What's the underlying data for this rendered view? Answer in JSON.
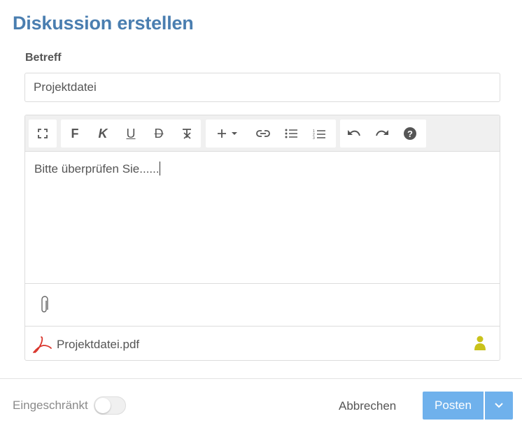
{
  "dialog": {
    "title": "Diskussion erstellen"
  },
  "subject": {
    "label": "Betreff",
    "value": "Projektdatei"
  },
  "editor": {
    "toolbar": {
      "fullscreen": "fullscreen-icon",
      "bold": "F",
      "italic": "K",
      "underline": "U",
      "strikethrough": "D",
      "clear_format": "clear-format-icon",
      "insert": "plus-icon",
      "link": "link-icon",
      "bullet_list": "bullet-list-icon",
      "numbered_list": "numbered-list-icon",
      "undo": "undo-icon",
      "redo": "redo-icon",
      "help": "help-icon"
    },
    "content": "Bitte überprüfen Sie......",
    "attachment": {
      "name": "Projektdatei.pdf",
      "icon": "pdf-icon",
      "owner_icon": "user-icon",
      "owner_color": "#c9c21b"
    }
  },
  "footer": {
    "restricted_label": "Eingeschränkt",
    "restricted_on": false,
    "cancel_label": "Abbrechen",
    "post_label": "Posten"
  },
  "colors": {
    "title": "#4a7eb0",
    "primary_button": "#6fb1ec",
    "pdf_red": "#d9342b"
  }
}
